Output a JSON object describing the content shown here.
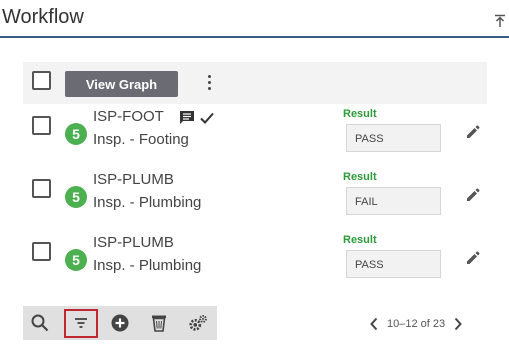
{
  "header": {
    "title": "Workflow",
    "collapse_icon": "collapse-up-icon"
  },
  "toolbar": {
    "view_graph_label": "View Graph",
    "more_icon": "more-vertical-icon"
  },
  "rows": [
    {
      "badge": "5",
      "code": "ISP-FOOT",
      "description": "Insp. - Footing",
      "result_label": "Result",
      "result": "PASS",
      "has_comment": true,
      "has_check": true
    },
    {
      "badge": "5",
      "code": "ISP-PLUMB",
      "description": "Insp. - Plumbing",
      "result_label": "Result",
      "result": "FAIL",
      "has_comment": false,
      "has_check": false
    },
    {
      "badge": "5",
      "code": "ISP-PLUMB",
      "description": "Insp. - Plumbing",
      "result_label": "Result",
      "result": "PASS",
      "has_comment": false,
      "has_check": false
    }
  ],
  "bottom_bar": {
    "icons": [
      "search-icon",
      "filter-icon",
      "add-circle-icon",
      "trash-icon",
      "settings-gears-icon"
    ]
  },
  "pager": {
    "range": "10–12 of 23"
  },
  "colors": {
    "badge": "#4caf50",
    "result_label": "#2e9b3a",
    "header_border": "#3a5a86",
    "filter_highlight": "#c0262d"
  }
}
